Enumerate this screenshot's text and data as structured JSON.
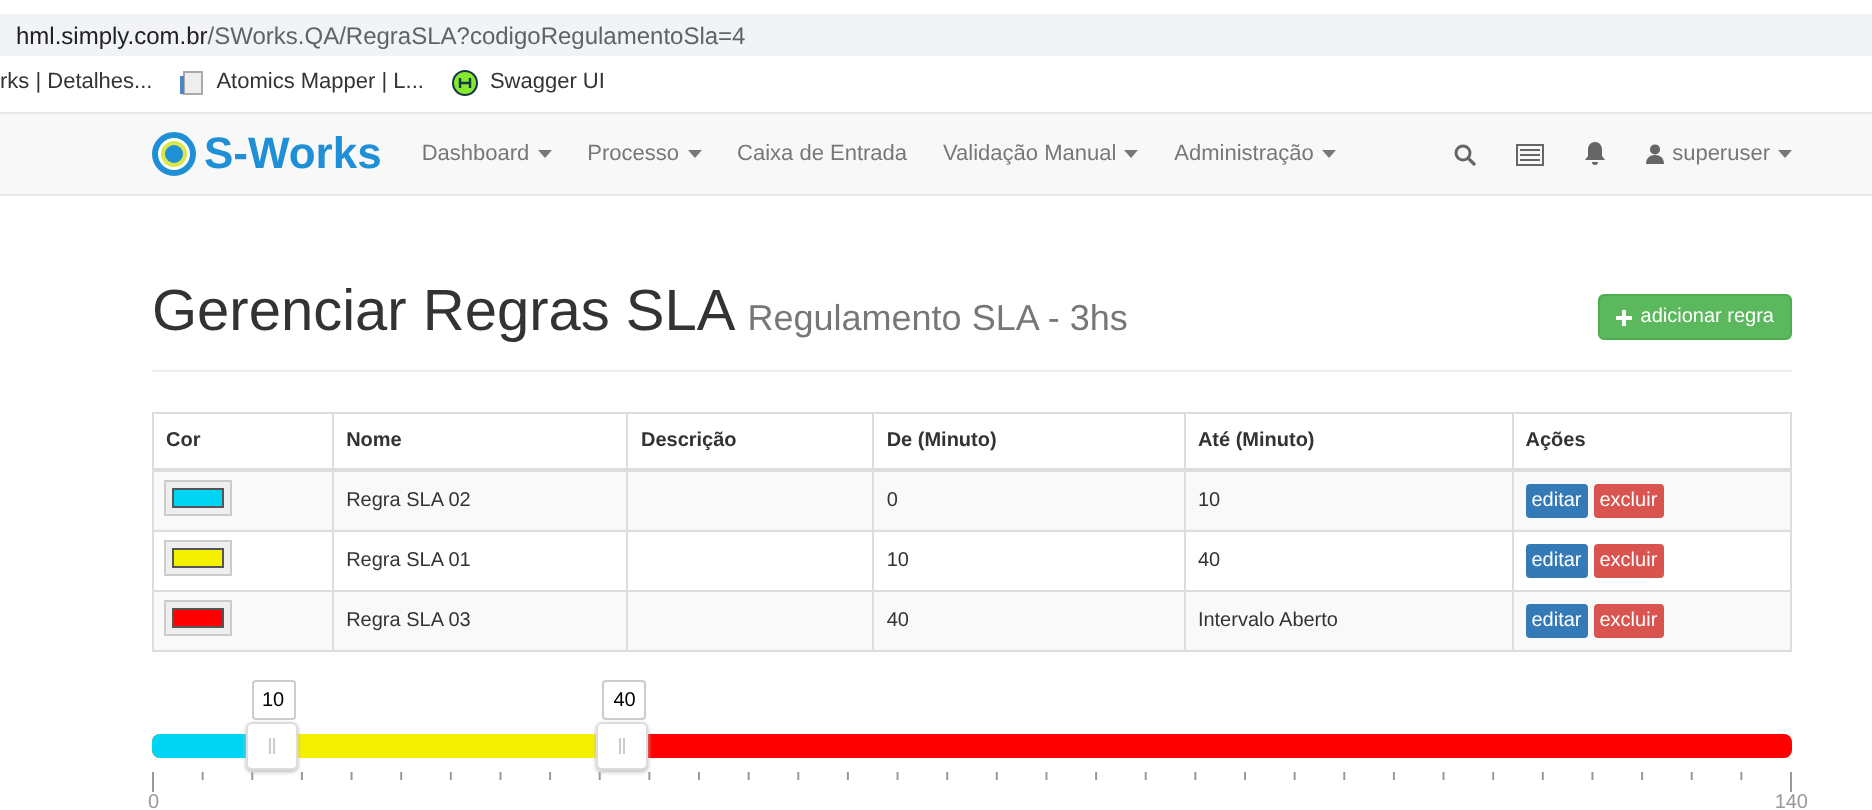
{
  "browser": {
    "url_host": "hml.simply.com.br",
    "url_path": "/SWorks.QA/RegraSLA?codigoRegulamentoSla=4",
    "bookmarks": [
      {
        "label": "rks | Detalhes...",
        "kind": "none"
      },
      {
        "label": "Atomics Mapper | L...",
        "kind": "page"
      },
      {
        "label": "Swagger UI",
        "kind": "swagger"
      }
    ]
  },
  "navbar": {
    "brand": "S-Works",
    "menu": [
      {
        "label": "Dashboard",
        "dropdown": true
      },
      {
        "label": "Processo",
        "dropdown": true
      },
      {
        "label": "Caixa de Entrada",
        "dropdown": false
      },
      {
        "label": "Validação Manual",
        "dropdown": true
      },
      {
        "label": "Administração",
        "dropdown": true
      }
    ],
    "user": "superuser"
  },
  "page": {
    "title": "Gerenciar Regras SLA",
    "subtitle": "Regulamento SLA - 3hs",
    "add_button": "adicionar regra"
  },
  "table": {
    "columns": [
      "Cor",
      "Nome",
      "Descrição",
      "De (Minuto)",
      "Até (Minuto)",
      "Ações"
    ],
    "rows": [
      {
        "color": "#00d4f5",
        "name": "Regra SLA 02",
        "from": "0",
        "to": "10",
        "actions": [
          "editar",
          "excluir"
        ]
      },
      {
        "color": "#f5f000",
        "name": "Regra SLA 01",
        "from": "10",
        "to": "40",
        "actions": [
          "editar",
          "excluir"
        ]
      },
      {
        "color": "#ff0000",
        "name": "Regra SLA 03",
        "from": "40",
        "to": "Intervalo Aberto",
        "actions": [
          "editar",
          "excluir"
        ]
      }
    ]
  },
  "slider": {
    "min": "0",
    "max": "140",
    "handles": [
      {
        "label": "10",
        "level": 0.0714
      },
      {
        "label": "40",
        "level": 0.2857
      }
    ],
    "segments": [
      {
        "color": "#00d4f5"
      },
      {
        "color": "#f5f000"
      },
      {
        "color": "#ff0000"
      }
    ]
  }
}
